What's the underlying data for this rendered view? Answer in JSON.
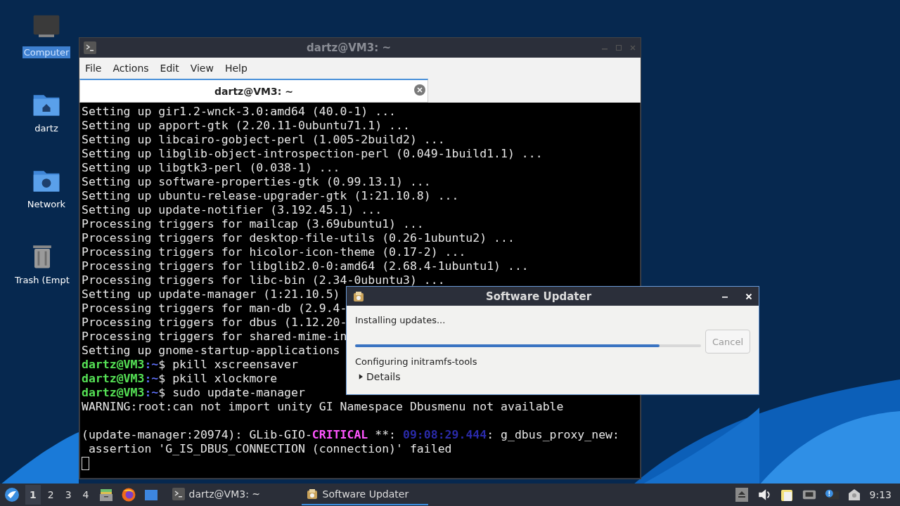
{
  "desktop_icons": [
    {
      "kind": "computer",
      "label": "Computer",
      "selected": true
    },
    {
      "kind": "home",
      "label": "dartz",
      "selected": false
    },
    {
      "kind": "network",
      "label": "Network",
      "selected": false
    },
    {
      "kind": "trash",
      "label": "Trash (Empt",
      "selected": false
    }
  ],
  "terminal": {
    "title": "dartz@VM3: ~",
    "menu": [
      "File",
      "Actions",
      "Edit",
      "View",
      "Help"
    ],
    "tab": {
      "title": "dartz@VM3: ~"
    },
    "lines": [
      {
        "segments": [
          {
            "text": "Setting up gir1.2-wnck-3.0:amd64 (40.0-1) ...",
            "color": "#e6e6e6"
          }
        ]
      },
      {
        "segments": [
          {
            "text": "Setting up apport-gtk (2.20.11-0ubuntu71.1) ...",
            "color": "#e6e6e6"
          }
        ]
      },
      {
        "segments": [
          {
            "text": "Setting up libcairo-gobject-perl (1.005-2build2) ...",
            "color": "#e6e6e6"
          }
        ]
      },
      {
        "segments": [
          {
            "text": "Setting up libglib-object-introspection-perl (0.049-1build1.1) ...",
            "color": "#e6e6e6"
          }
        ]
      },
      {
        "segments": [
          {
            "text": "Setting up libgtk3-perl (0.038-1) ...",
            "color": "#e6e6e6"
          }
        ]
      },
      {
        "segments": [
          {
            "text": "Setting up software-properties-gtk (0.99.13.1) ...",
            "color": "#e6e6e6"
          }
        ]
      },
      {
        "segments": [
          {
            "text": "Setting up ubuntu-release-upgrader-gtk (1:21.10.8) ...",
            "color": "#e6e6e6"
          }
        ]
      },
      {
        "segments": [
          {
            "text": "Setting up update-notifier (3.192.45.1) ...",
            "color": "#e6e6e6"
          }
        ]
      },
      {
        "segments": [
          {
            "text": "Processing triggers for mailcap (3.69ubuntu1) ...",
            "color": "#e6e6e6"
          }
        ]
      },
      {
        "segments": [
          {
            "text": "Processing triggers for desktop-file-utils (0.26-1ubuntu2) ...",
            "color": "#e6e6e6"
          }
        ]
      },
      {
        "segments": [
          {
            "text": "Processing triggers for hicolor-icon-theme (0.17-2) ...",
            "color": "#e6e6e6"
          }
        ]
      },
      {
        "segments": [
          {
            "text": "Processing triggers for libglib2.0-0:amd64 (2.68.4-1ubuntu1) ...",
            "color": "#e6e6e6"
          }
        ]
      },
      {
        "segments": [
          {
            "text": "Processing triggers for libc-bin (2.34-0ubuntu3) ...",
            "color": "#e6e6e6"
          }
        ]
      },
      {
        "segments": [
          {
            "text": "Setting up update-manager (1:21.10.5)",
            "color": "#e6e6e6"
          }
        ]
      },
      {
        "segments": [
          {
            "text": "Processing triggers for man-db (2.9.4-",
            "color": "#e6e6e6"
          }
        ]
      },
      {
        "segments": [
          {
            "text": "Processing triggers for dbus (1.12.20-",
            "color": "#e6e6e6"
          }
        ]
      },
      {
        "segments": [
          {
            "text": "Processing triggers for shared-mime-in",
            "color": "#e6e6e6"
          }
        ]
      },
      {
        "segments": [
          {
            "text": "Setting up gnome-startup-applications",
            "color": "#e6e6e6"
          }
        ]
      },
      {
        "segments": [
          {
            "text": "dartz@VM3",
            "color": "#55e055"
          },
          {
            "text": ":~",
            "color": "#5b6cf0"
          },
          {
            "text": "$ pkill xscreensaver",
            "color": "#e6e6e6"
          }
        ]
      },
      {
        "segments": [
          {
            "text": "dartz@VM3",
            "color": "#55e055"
          },
          {
            "text": ":~",
            "color": "#5b6cf0"
          },
          {
            "text": "$ pkill xlockmore",
            "color": "#e6e6e6"
          }
        ]
      },
      {
        "segments": [
          {
            "text": "dartz@VM3",
            "color": "#55e055"
          },
          {
            "text": ":~",
            "color": "#5b6cf0"
          },
          {
            "text": "$ sudo update-manager",
            "color": "#e6e6e6"
          }
        ]
      },
      {
        "segments": [
          {
            "text": "WARNING:root:can not import unity GI Namespace Dbusmenu not available",
            "color": "#e6e6e6"
          }
        ]
      },
      {
        "kind": "blank"
      },
      {
        "segments": [
          {
            "text": "(update-manager:20974): GLib-GIO-",
            "color": "#e6e6e6"
          },
          {
            "text": "CRITICAL",
            "color": "#ff55ff"
          },
          {
            "text": " **: ",
            "color": "#e6e6e6"
          },
          {
            "text": "09:08:29.444",
            "color": "#2a2aa8"
          },
          {
            "text": ": g_dbus_proxy_new:",
            "color": "#e6e6e6"
          }
        ]
      },
      {
        "segments": [
          {
            "text": " assertion 'G_IS_DBUS_CONNECTION (connection)' failed",
            "color": "#e6e6e6"
          }
        ]
      }
    ]
  },
  "dialog": {
    "title": "Software Updater",
    "status": "Installing updates...",
    "progress": {
      "level": 0.88
    },
    "cancel": {
      "label": "Cancel",
      "disabled": true
    },
    "detail": "Configuring initramfs-tools",
    "expander": {
      "label": "Details",
      "expanded": false
    }
  },
  "taskbar": {
    "workspaces": [
      {
        "label": "1",
        "selected": true
      },
      {
        "label": "2",
        "selected": false
      },
      {
        "label": "3",
        "selected": false
      },
      {
        "label": "4",
        "selected": false
      }
    ],
    "tasks": [
      {
        "kind": "terminal",
        "label": "dartz@VM3: ~",
        "selected": false
      },
      {
        "kind": "updater",
        "label": "Software Updater",
        "selected": true
      }
    ],
    "clock": "9:13"
  }
}
